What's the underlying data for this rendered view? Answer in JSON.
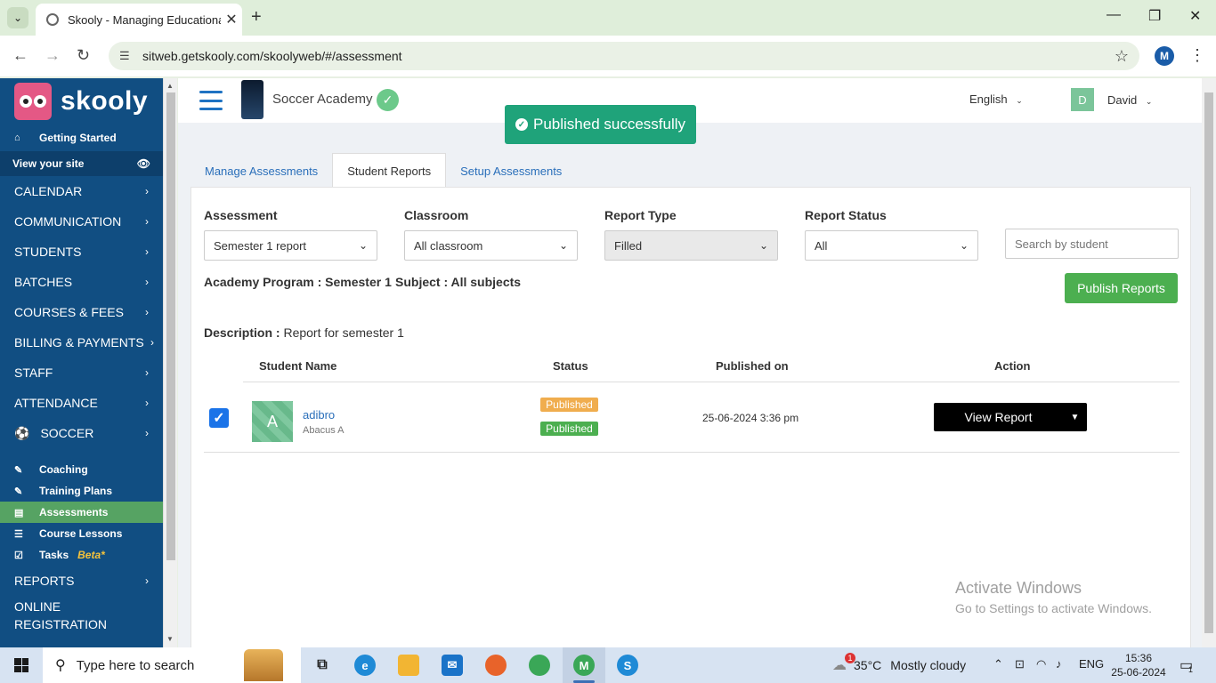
{
  "browser": {
    "tab_title": "Skooly - Managing Educational",
    "tab_close": "✕",
    "new_tab": "+",
    "url": "sitweb.getskooly.com/skoolyweb/#/assessment",
    "profile_initial": "M"
  },
  "sidebar": {
    "brand": "skooly",
    "getting_started": "Getting Started",
    "view_site": "View your site",
    "menu": [
      {
        "label": "CALENDAR"
      },
      {
        "label": "COMMUNICATION"
      },
      {
        "label": "STUDENTS"
      },
      {
        "label": "BATCHES"
      },
      {
        "label": "COURSES & FEES"
      },
      {
        "label": "BILLING & PAYMENTS"
      },
      {
        "label": "STAFF"
      },
      {
        "label": "ATTENDANCE"
      },
      {
        "label": "SOCCER"
      }
    ],
    "soccer_sub": [
      {
        "label": "Coaching"
      },
      {
        "label": "Training Plans"
      },
      {
        "label": "Assessments"
      },
      {
        "label": "Course Lessons"
      },
      {
        "label": "Tasks",
        "badge": "Beta*"
      }
    ],
    "reports": "REPORTS",
    "online_registration": "ONLINE REGISTRATION"
  },
  "header": {
    "academy_name": "Soccer Academy",
    "language": "English",
    "user_initial": "D",
    "user_name": "David"
  },
  "toast": {
    "message": "Published successfully"
  },
  "tabs": [
    {
      "label": "Manage Assessments"
    },
    {
      "label": "Student Reports"
    },
    {
      "label": "Setup Assessments"
    }
  ],
  "filters": {
    "assessment": {
      "label": "Assessment",
      "value": "Semester 1 report"
    },
    "classroom": {
      "label": "Classroom",
      "value": "All classroom"
    },
    "report_type": {
      "label": "Report Type",
      "value": "Filled"
    },
    "report_status": {
      "label": "Report Status",
      "value": "All"
    },
    "search_placeholder": "Search by student"
  },
  "info": {
    "academy_program": "Academy Program : Semester 1",
    "subject": "Subject : All subjects",
    "description_label": "Description :",
    "description_value": " Report for semester 1"
  },
  "publish_button": "Publish Reports",
  "table": {
    "headers": [
      "Student Name",
      "Status",
      "Published on",
      "Action"
    ],
    "rows": [
      {
        "checked": true,
        "initial": "A",
        "name": "adibro",
        "subtitle": "Abacus A",
        "status1": "Published",
        "status2": "Published",
        "published_on": "25-06-2024 3:36 pm",
        "action": "View Report"
      }
    ]
  },
  "watermark": {
    "line1": "Activate Windows",
    "line2": "Go to Settings to activate Windows."
  },
  "taskbar": {
    "search_placeholder": "Type here to search",
    "weather_temp": "35°C",
    "weather_desc": "Mostly cloudy",
    "weather_badge": "1",
    "lang": "ENG",
    "time": "15:36",
    "date": "25-06-2024",
    "notif_count": "1"
  }
}
